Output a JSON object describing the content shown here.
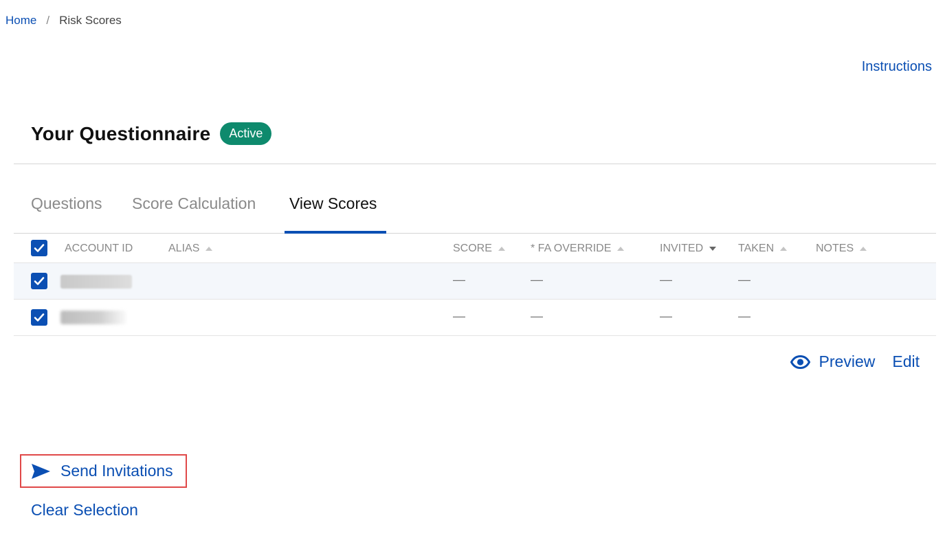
{
  "breadcrumb": {
    "home": "Home",
    "separator": "/",
    "current": "Risk Scores"
  },
  "header": {
    "instructions": "Instructions"
  },
  "questionnaire": {
    "title": "Your Questionnaire",
    "status": "Active",
    "status_color": "#0e8a6d"
  },
  "tabs": [
    {
      "label": "Questions",
      "active": false
    },
    {
      "label": "Score Calculation",
      "active": false
    },
    {
      "label": "View Scores",
      "active": true
    }
  ],
  "table": {
    "columns": [
      {
        "label": "ACCOUNT ID",
        "sort": "none"
      },
      {
        "label": "ALIAS",
        "sort": "asc"
      },
      {
        "label": "SCORE",
        "sort": "asc"
      },
      {
        "label": "* FA OVERRIDE",
        "sort": "asc"
      },
      {
        "label": "INVITED",
        "sort": "desc"
      },
      {
        "label": "TAKEN",
        "sort": "asc"
      },
      {
        "label": "NOTES",
        "sort": "asc"
      }
    ],
    "header_checked": true,
    "rows": [
      {
        "checked": true,
        "account_id": "",
        "alias": "",
        "score": "—",
        "fa_override": "—",
        "invited": "—",
        "taken": "—",
        "notes": ""
      },
      {
        "checked": true,
        "account_id": "",
        "alias": "",
        "score": "—",
        "fa_override": "—",
        "invited": "—",
        "taken": "—",
        "notes": ""
      }
    ]
  },
  "actions": {
    "preview": "Preview",
    "edit": "Edit",
    "preview_icon": "eye-icon"
  },
  "footer": {
    "send_invitations": "Send Invitations",
    "send_icon": "send-icon",
    "clear_selection": "Clear Selection"
  },
  "colors": {
    "accent": "#0b4fb3",
    "highlight_border": "#e04848"
  }
}
